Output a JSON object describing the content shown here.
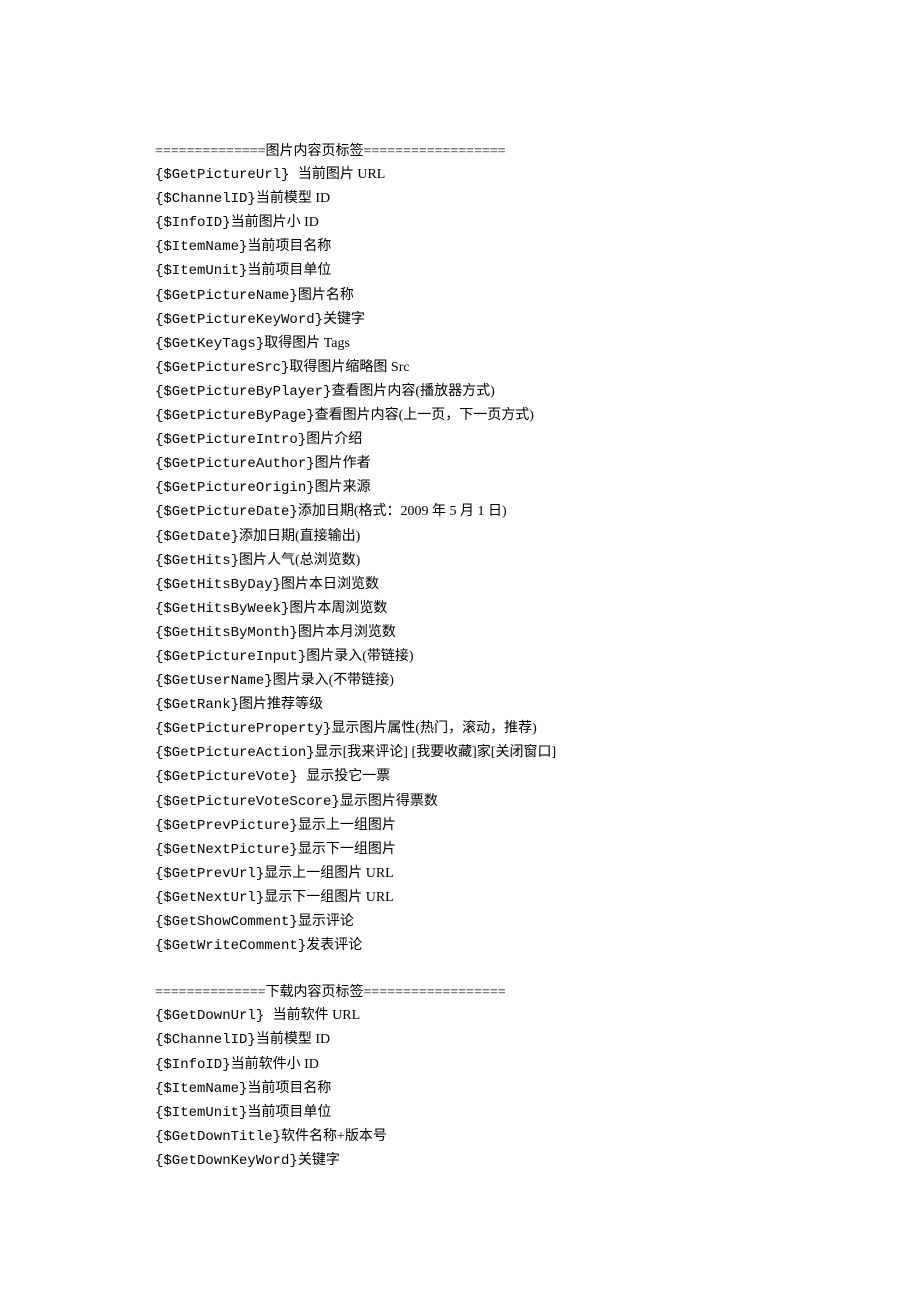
{
  "sections": [
    {
      "header": "==============图片内容页标签==================",
      "items": [
        {
          "tag": "{$GetPictureUrl} ",
          "desc": "当前图片 URL"
        },
        {
          "tag": "{$ChannelID}",
          "desc": "当前模型 ID"
        },
        {
          "tag": "{$InfoID}",
          "desc": "当前图片小 ID"
        },
        {
          "tag": "{$ItemName}",
          "desc": "当前项目名称"
        },
        {
          "tag": "{$ItemUnit}",
          "desc": "当前项目单位"
        },
        {
          "tag": "{$GetPictureName}",
          "desc": "图片名称"
        },
        {
          "tag": "{$GetPictureKeyWord}",
          "desc": "关键字"
        },
        {
          "tag": "{$GetKeyTags}",
          "desc": "取得图片 Tags"
        },
        {
          "tag": "{$GetPictureSrc}",
          "desc": "取得图片缩略图 Src"
        },
        {
          "tag": "{$GetPictureByPlayer}",
          "desc": "查看图片内容(播放器方式)"
        },
        {
          "tag": "{$GetPictureByPage}",
          "desc": "查看图片内容(上一页，下一页方式)"
        },
        {
          "tag": "{$GetPictureIntro}",
          "desc": "图片介绍"
        },
        {
          "tag": "{$GetPictureAuthor}",
          "desc": "图片作者"
        },
        {
          "tag": "{$GetPictureOrigin}",
          "desc": "图片来源"
        },
        {
          "tag": "{$GetPictureDate}",
          "desc": "添加日期(格式：2009 年 5 月 1 日)"
        },
        {
          "tag": "{$GetDate}",
          "desc": "添加日期(直接输出)"
        },
        {
          "tag": "{$GetHits}",
          "desc": "图片人气(总浏览数)"
        },
        {
          "tag": "{$GetHitsByDay}",
          "desc": "图片本日浏览数"
        },
        {
          "tag": "{$GetHitsByWeek}",
          "desc": "图片本周浏览数"
        },
        {
          "tag": "{$GetHitsByMonth}",
          "desc": "图片本月浏览数"
        },
        {
          "tag": "{$GetPictureInput}",
          "desc": "图片录入(带链接)"
        },
        {
          "tag": "{$GetUserName}",
          "desc": "图片录入(不带链接)"
        },
        {
          "tag": "{$GetRank}",
          "desc": "图片推荐等级"
        },
        {
          "tag": "{$GetPictureProperty}",
          "desc": "显示图片属性(热门，滚动，推荐)"
        },
        {
          "tag": "{$GetPictureAction}",
          "desc": "显示[我来评论] [我要收藏]家[关闭窗口]"
        },
        {
          "tag": "{$GetPictureVote} ",
          "desc": "显示投它一票"
        },
        {
          "tag": "{$GetPictureVoteScore}",
          "desc": "显示图片得票数"
        },
        {
          "tag": "{$GetPrevPicture}",
          "desc": "显示上一组图片"
        },
        {
          "tag": "{$GetNextPicture}",
          "desc": "显示下一组图片"
        },
        {
          "tag": "{$GetPrevUrl}",
          "desc": "显示上一组图片 URL"
        },
        {
          "tag": "{$GetNextUrl}",
          "desc": "显示下一组图片 URL"
        },
        {
          "tag": "{$GetShowComment}",
          "desc": "显示评论"
        },
        {
          "tag": "{$GetWriteComment}",
          "desc": "发表评论"
        }
      ]
    },
    {
      "header": "==============下载内容页标签==================",
      "items": [
        {
          "tag": "{$GetDownUrl} ",
          "desc": "当前软件 URL"
        },
        {
          "tag": "{$ChannelID}",
          "desc": "当前模型 ID"
        },
        {
          "tag": "{$InfoID}",
          "desc": "当前软件小 ID"
        },
        {
          "tag": "{$ItemName}",
          "desc": "当前项目名称"
        },
        {
          "tag": "{$ItemUnit}",
          "desc": "当前项目单位"
        },
        {
          "tag": "{$GetDownTitle}",
          "desc": "软件名称+版本号"
        },
        {
          "tag": "{$GetDownKeyWord}",
          "desc": "关键字"
        }
      ]
    }
  ]
}
